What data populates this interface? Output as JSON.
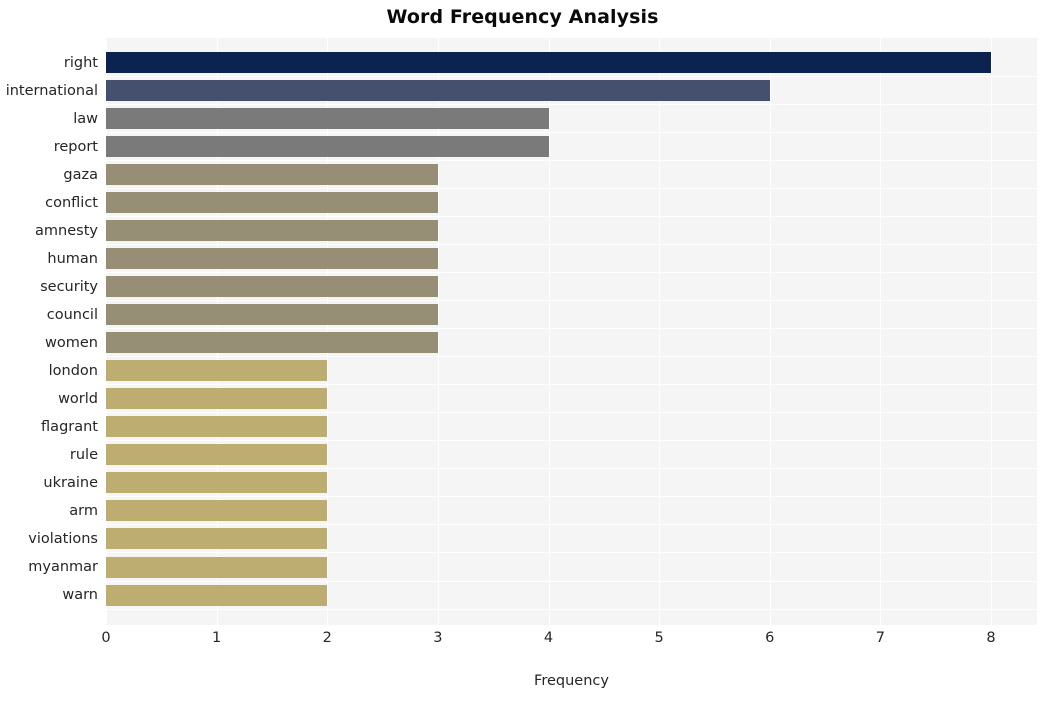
{
  "chart_data": {
    "type": "bar",
    "orientation": "horizontal",
    "title": "Word Frequency Analysis",
    "xlabel": "Frequency",
    "ylabel": "",
    "categories": [
      "right",
      "international",
      "law",
      "report",
      "gaza",
      "conflict",
      "amnesty",
      "human",
      "security",
      "council",
      "women",
      "london",
      "world",
      "flagrant",
      "rule",
      "ukraine",
      "arm",
      "violations",
      "myanmar",
      "warn"
    ],
    "values": [
      8,
      6,
      4,
      4,
      3,
      3,
      3,
      3,
      3,
      3,
      3,
      2,
      2,
      2,
      2,
      2,
      2,
      2,
      2,
      2
    ],
    "bar_colors": [
      "#0a2350",
      "#454f6e",
      "#7b7a7a",
      "#7b7a7a",
      "#968f76",
      "#968f76",
      "#968f76",
      "#968f76",
      "#968f76",
      "#968f76",
      "#968f76",
      "#bdad70",
      "#bdad70",
      "#bdad70",
      "#bdad70",
      "#bdad70",
      "#bdad70",
      "#bdad70",
      "#bdad70",
      "#bdad70"
    ],
    "xlim": [
      0,
      8
    ],
    "xticks": [
      0,
      1,
      2,
      3,
      4,
      5,
      6,
      7,
      8
    ],
    "xtick_labels": [
      "0",
      "1",
      "2",
      "3",
      "4",
      "5",
      "6",
      "7",
      "8"
    ],
    "grid": true,
    "grid_color": "#ffffff",
    "plot_background": "#f5f5f6",
    "figure_background": "#ffffff",
    "legend": null
  },
  "style": {
    "title_color": "#0a0a0a",
    "tick_color": "#262626"
  }
}
